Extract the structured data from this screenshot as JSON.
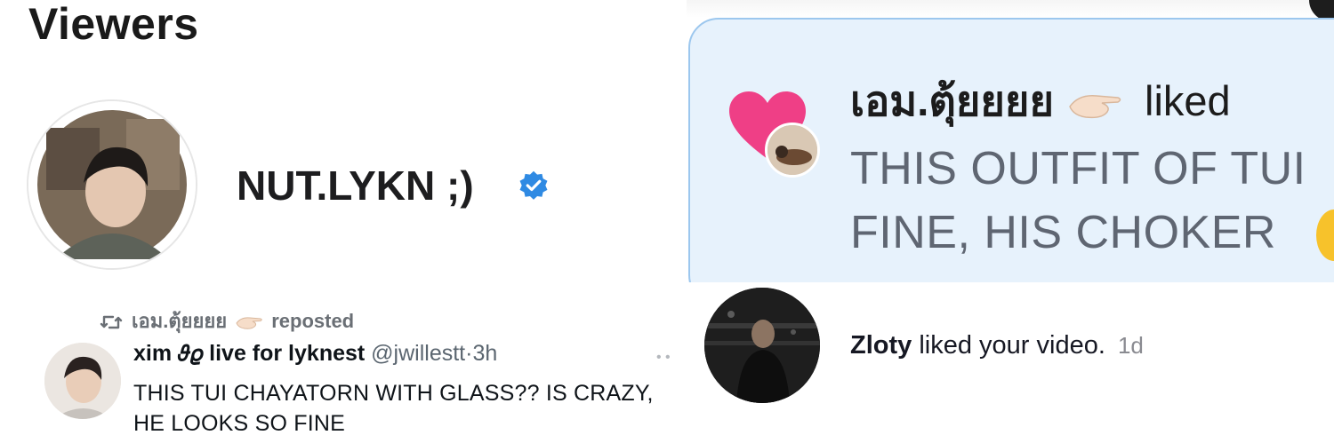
{
  "viewers": {
    "title": "Viewers",
    "viewer_name": "NUT.LYKN ;)"
  },
  "notification_card": {
    "username": "เอม.ตุ้ยยยย",
    "action": "liked",
    "comment_line1": "THIS OUTFIT OF TUI",
    "comment_line2": "FINE, HIS CHOKER"
  },
  "tweet": {
    "repost_user": "เอม.ตุ้ยยยย",
    "repost_label": "reposted",
    "display_name": "xim 𝜗𝜚 live for lyknest",
    "handle": "@jwillestt",
    "separator": "·",
    "time": "3h",
    "text": "THIS TUI CHAYATORN WITH GLASS?? IS CRAZY, HE LOOKS SO FINE"
  },
  "tiktok_notification": {
    "username": "Zloty",
    "action": "liked your video.",
    "time": "1d"
  },
  "colors": {
    "verified_blue": "#2f8ae3",
    "heart_pink": "#ef3f86",
    "card_bg": "#e7f2fc",
    "card_border": "#9cc7ee"
  },
  "icons": [
    "verified-badge-icon",
    "heart-icon",
    "hand-emoji-icon",
    "repost-icon"
  ]
}
